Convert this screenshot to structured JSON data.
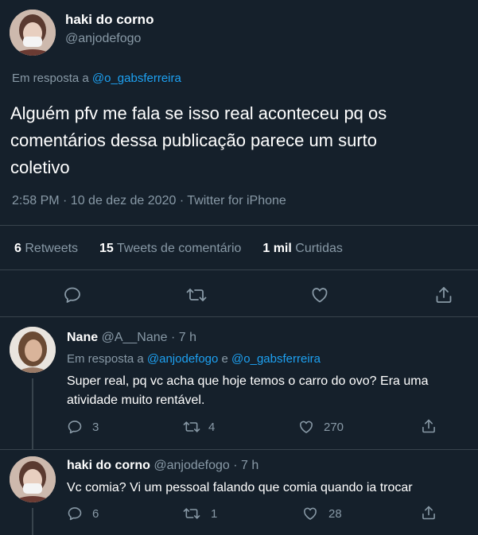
{
  "main_tweet": {
    "display_name": "haki do corno",
    "handle": "@anjodefogo",
    "reply_prefix": "Em resposta a",
    "reply_to": "@o_gabsferreira",
    "text_line1": "Alguém pfv me fala se isso real aconteceu pq os",
    "text_line2": "comentários dessa publicação parece um surto",
    "text_line3": "coletivo",
    "meta": "2:58 PM · 10 de dez de 2020 · Twitter for iPhone",
    "retweets_count": "6",
    "retweets_label": "Retweets",
    "comments_count": "15",
    "comments_label": "Tweets de comentário",
    "likes_count": "1 mil",
    "likes_label": "Curtidas"
  },
  "replies": [
    {
      "display_name": "Nane",
      "handle_time": "@A__Nane · 7 h",
      "reply_prefix": "Em resposta a",
      "reply_to_1": "@anjodefogo",
      "reply_and": "e",
      "reply_to_2": "@o_gabsferreira",
      "text_line1": "Super real, pq vc acha que hoje temos o carro do ovo? Era uma",
      "text_line2": "atividade muito rentável.",
      "reply_count": "3",
      "retweet_count": "4",
      "like_count": "270"
    },
    {
      "display_name": "haki do corno",
      "handle_time": "@anjodefogo · 7 h",
      "text_line1": "Vc comia? Vi um pessoal falando que comia quando ia trocar",
      "reply_count": "6",
      "retweet_count": "1",
      "like_count": "28"
    }
  ],
  "colors": {
    "background": "#15202b",
    "muted": "#8899a6",
    "accent": "#1da1f2",
    "divider": "#38444d"
  },
  "icons": [
    "reply-icon",
    "retweet-icon",
    "like-icon",
    "share-icon"
  ]
}
